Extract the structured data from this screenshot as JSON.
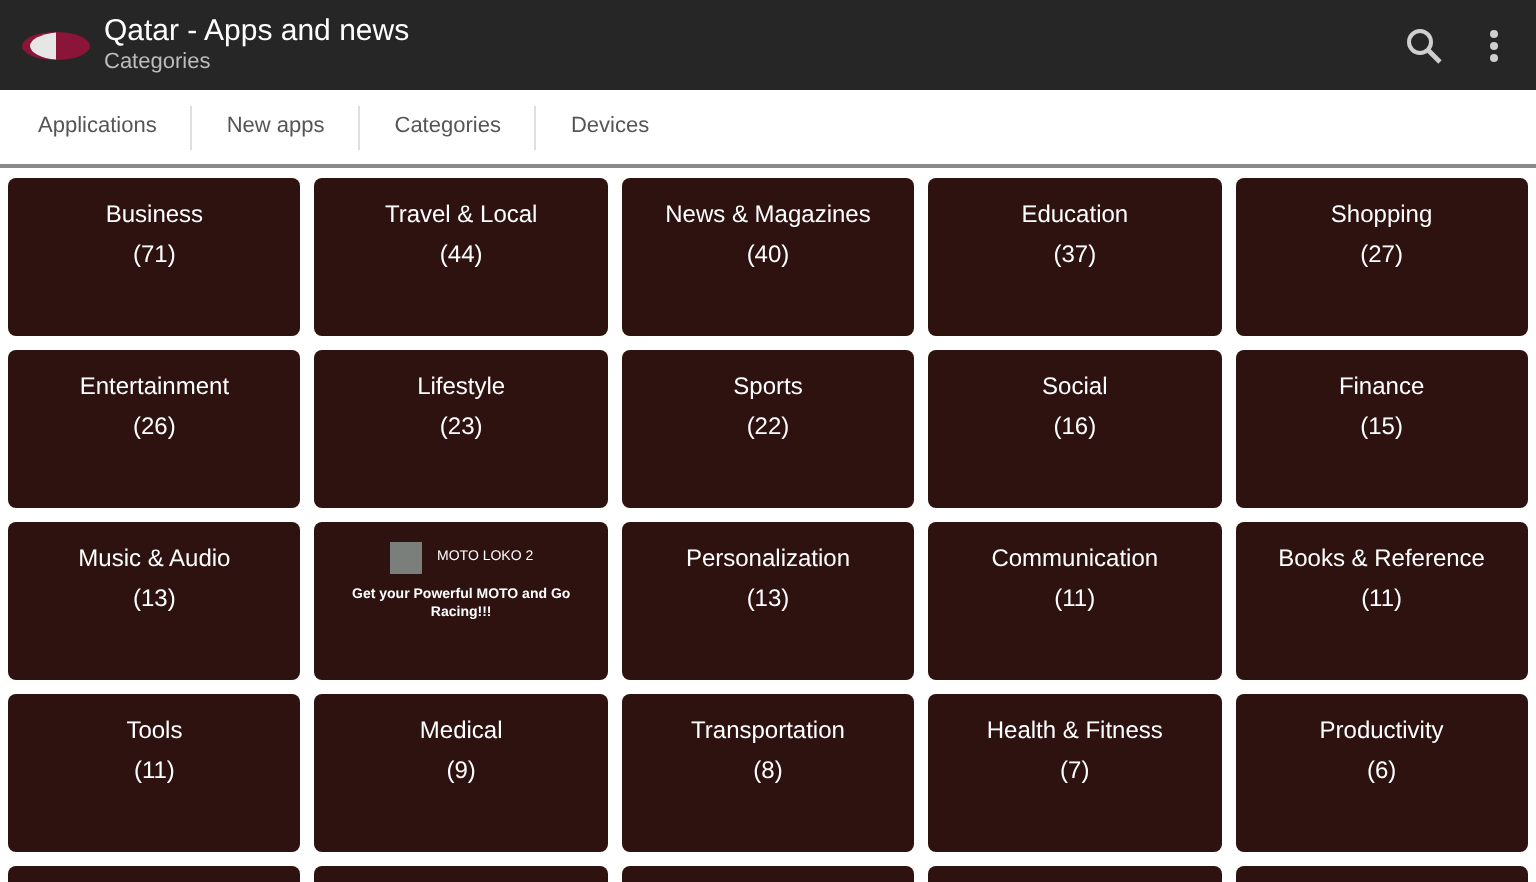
{
  "app_bar": {
    "title": "Qatar - Apps and news",
    "subtitle": "Categories"
  },
  "tabs": [
    {
      "label": "Applications"
    },
    {
      "label": "New apps"
    },
    {
      "label": "Categories"
    },
    {
      "label": "Devices"
    }
  ],
  "tiles": [
    {
      "kind": "category",
      "name": "Business",
      "count": "(71)"
    },
    {
      "kind": "category",
      "name": "Travel & Local",
      "count": "(44)"
    },
    {
      "kind": "category",
      "name": "News & Magazines",
      "count": "(40)"
    },
    {
      "kind": "category",
      "name": "Education",
      "count": "(37)"
    },
    {
      "kind": "category",
      "name": "Shopping",
      "count": "(27)"
    },
    {
      "kind": "category",
      "name": "Entertainment",
      "count": "(26)"
    },
    {
      "kind": "category",
      "name": "Lifestyle",
      "count": "(23)"
    },
    {
      "kind": "category",
      "name": "Sports",
      "count": "(22)"
    },
    {
      "kind": "category",
      "name": "Social",
      "count": "(16)"
    },
    {
      "kind": "category",
      "name": "Finance",
      "count": "(15)"
    },
    {
      "kind": "category",
      "name": "Music & Audio",
      "count": "(13)"
    },
    {
      "kind": "ad",
      "name": "MOTO LOKO 2",
      "text": "Get your Powerful MOTO and Go Racing!!!"
    },
    {
      "kind": "category",
      "name": "Personalization",
      "count": "(13)"
    },
    {
      "kind": "category",
      "name": "Communication",
      "count": "(11)"
    },
    {
      "kind": "category",
      "name": "Books & Reference",
      "count": "(11)"
    },
    {
      "kind": "category",
      "name": "Tools",
      "count": "(11)"
    },
    {
      "kind": "category",
      "name": "Medical",
      "count": "(9)"
    },
    {
      "kind": "category",
      "name": "Transportation",
      "count": "(8)"
    },
    {
      "kind": "category",
      "name": "Health & Fitness",
      "count": "(7)"
    },
    {
      "kind": "category",
      "name": "Productivity",
      "count": "(6)"
    },
    {
      "kind": "cut"
    },
    {
      "kind": "cut"
    },
    {
      "kind": "cut"
    },
    {
      "kind": "cut"
    },
    {
      "kind": "cut"
    }
  ]
}
